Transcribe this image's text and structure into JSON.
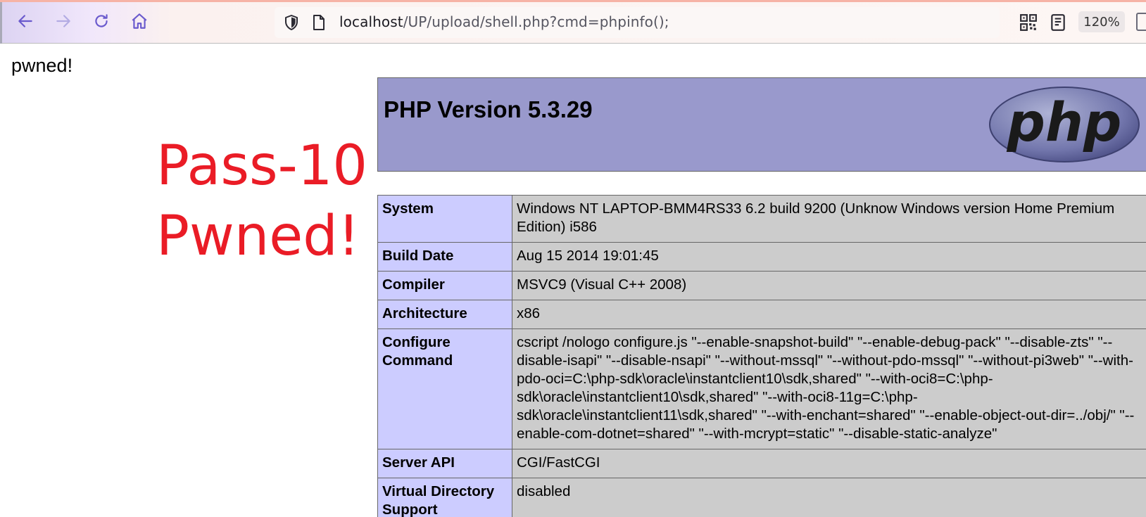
{
  "browser": {
    "url_host": "localhost",
    "url_path": "/UP/upload/shell.php?cmd=phpinfo();",
    "zoom_level": "120%",
    "icons": {
      "back": "arrow-left-icon",
      "forward": "arrow-right-icon",
      "reload": "reload-icon",
      "home": "home-icon",
      "security": "shield-icon",
      "page_info": "page-icon",
      "qr": "qr-code-icon",
      "reader": "reader-view-icon"
    },
    "colors": {
      "accent": "#f6b3a6",
      "icon": "#6a5acd"
    }
  },
  "page": {
    "pwned_text": "pwned!",
    "overlay_line1": "Pass-10",
    "overlay_line2": "Pwned!",
    "overlay_color": "#ea1c26"
  },
  "phpinfo": {
    "title": "PHP Version 5.3.29",
    "logo_text": "php",
    "header_color": "#9999cc",
    "rows": [
      {
        "label": "System",
        "value": "Windows NT LAPTOP-BMM4RS33 6.2 build 9200 (Unknow Windows version Home Premium Edition) i586"
      },
      {
        "label": "Build Date",
        "value": "Aug 15 2014 19:01:45"
      },
      {
        "label": "Compiler",
        "value": "MSVC9 (Visual C++ 2008)"
      },
      {
        "label": "Architecture",
        "value": "x86"
      },
      {
        "label": "Configure Command",
        "value": "cscript /nologo configure.js \"--enable-snapshot-build\" \"--enable-debug-pack\" \"--disable-zts\" \"--disable-isapi\" \"--disable-nsapi\" \"--without-mssql\" \"--without-pdo-mssql\" \"--without-pi3web\" \"--with-pdo-oci=C:\\php-sdk\\oracle\\instantclient10\\sdk,shared\" \"--with-oci8=C:\\php-sdk\\oracle\\instantclient10\\sdk,shared\" \"--with-oci8-11g=C:\\php-sdk\\oracle\\instantclient11\\sdk,shared\" \"--with-enchant=shared\" \"--enable-object-out-dir=../obj/\" \"--enable-com-dotnet=shared\" \"--with-mcrypt=static\" \"--disable-static-analyze\""
      },
      {
        "label": "Server API",
        "value": "CGI/FastCGI"
      },
      {
        "label": "Virtual Directory Support",
        "value": "disabled"
      }
    ]
  }
}
